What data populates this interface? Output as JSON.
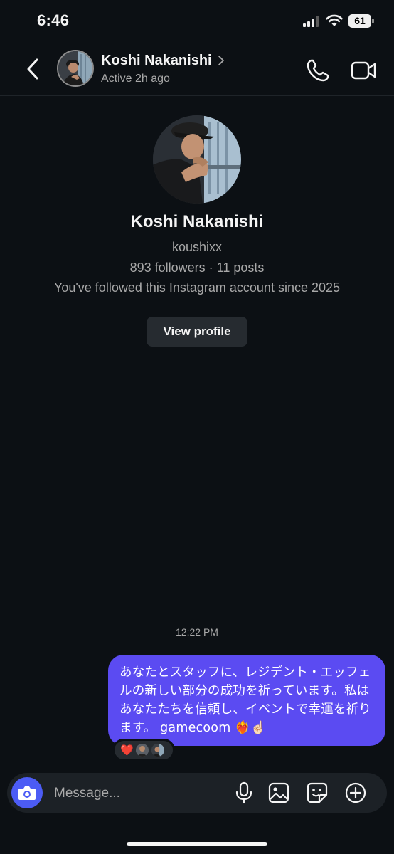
{
  "status_bar": {
    "time": "6:46",
    "battery_level": "61"
  },
  "header": {
    "contact_name": "Koshi Nakanishi",
    "activity_status": "Active 2h ago"
  },
  "profile": {
    "name": "Koshi Nakanishi",
    "username": "koushixx",
    "stats": "893 followers · 11 posts",
    "follow_note": "You've followed this Instagram account since 2025",
    "view_profile_label": "View profile"
  },
  "conversation": {
    "timestamp": "12:22 PM",
    "messages": [
      {
        "sender": "me",
        "text": "あなたとスタッフに、レジデント・エッフェルの新しい部分の成功を祈っています。私はあなたたちを信頼し、イベントで幸運を祈ります。 gamecoom ❤️‍🔥☝🏻"
      }
    ],
    "reaction": "❤️"
  },
  "composer": {
    "placeholder": "Message..."
  },
  "colors": {
    "background": "#0c1014",
    "bubble": "#5b4bf2",
    "camera_button": "#4c5cf5",
    "reaction_heart": "#ff3040"
  },
  "icons": [
    "back-arrow-icon",
    "chevron-right-icon",
    "phone-icon",
    "video-camera-icon",
    "camera-icon",
    "microphone-icon",
    "gallery-icon",
    "sticker-icon",
    "plus-circle-icon",
    "signal-icon",
    "wifi-icon",
    "battery-icon"
  ]
}
